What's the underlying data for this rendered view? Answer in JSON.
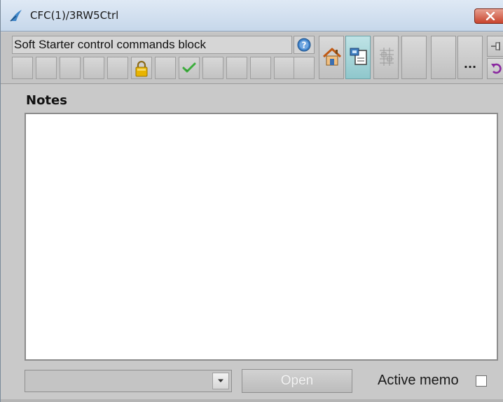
{
  "window": {
    "title": "CFC(1)/3RW5Ctrl"
  },
  "toolbar": {
    "block_name": "Soft Starter control commands block",
    "more_label": "...",
    "icons": {
      "help": "help-icon",
      "lock": "lock-icon",
      "check": "check-icon",
      "home": "home-icon",
      "faceplate": "faceplate-view-icon",
      "trend": "trend-grid-icon",
      "pin": "pin-icon",
      "undo": "undo-icon"
    }
  },
  "notes": {
    "label": "Notes",
    "value": ""
  },
  "footer": {
    "memo_select_value": "",
    "open_label": "Open",
    "active_memo_label": "Active memo",
    "active_memo_checked": false
  },
  "colors": {
    "title_bar": "#c6d7ea",
    "close_button": "#c8442e",
    "panel_background": "#c9c9c9",
    "active_view_button": "#8fc7cc",
    "lock_yellow": "#e8b400",
    "check_green": "#3cae3c"
  }
}
